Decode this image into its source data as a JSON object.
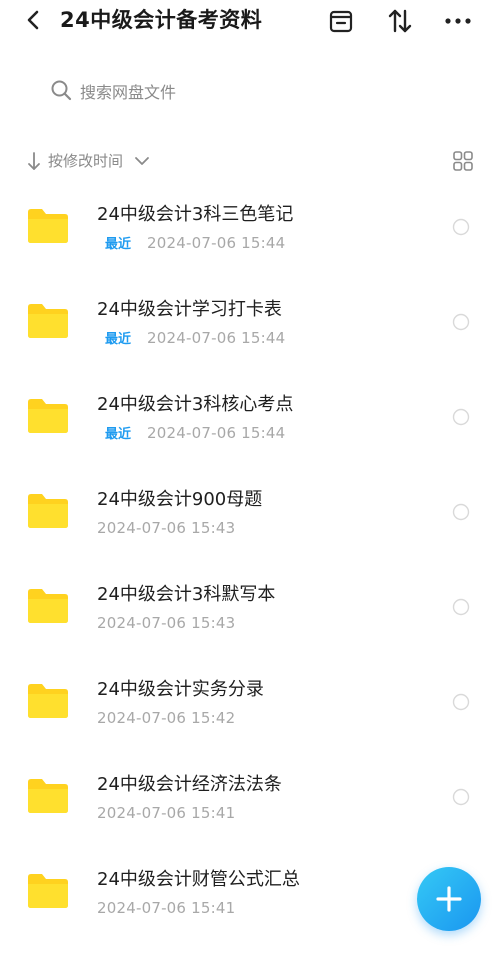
{
  "header": {
    "title": "24中级会计备考资料",
    "back_icon": "chevron-left-icon",
    "actions": [
      "transfer-box-icon",
      "sort-swap-icon",
      "more-dots-icon"
    ]
  },
  "search": {
    "placeholder": "搜索网盘文件"
  },
  "sort": {
    "label": "按修改时间",
    "view_toggle_icon": "grid-view-icon"
  },
  "files": [
    {
      "name": "24中级会计3科三色笔记",
      "badge": "最近",
      "date": "2024-07-06  15:44"
    },
    {
      "name": "24中级会计学习打卡表",
      "badge": "最近",
      "date": "2024-07-06  15:44"
    },
    {
      "name": "24中级会计3科核心考点",
      "badge": "最近",
      "date": "2024-07-06  15:44"
    },
    {
      "name": "24中级会计900母题",
      "badge": "",
      "date": "2024-07-06  15:43"
    },
    {
      "name": "24中级会计3科默写本",
      "badge": "",
      "date": "2024-07-06  15:43"
    },
    {
      "name": "24中级会计实务分录",
      "badge": "",
      "date": "2024-07-06  15:42"
    },
    {
      "name": "24中级会计经济法法条",
      "badge": "",
      "date": "2024-07-06  15:41"
    },
    {
      "name": "24中级会计财管公式汇总",
      "badge": "",
      "date": "2024-07-06  15:41"
    }
  ],
  "colors": {
    "folder": "#FFD21F",
    "badge": "#1E9BF0",
    "fab": "#1A96F0"
  }
}
